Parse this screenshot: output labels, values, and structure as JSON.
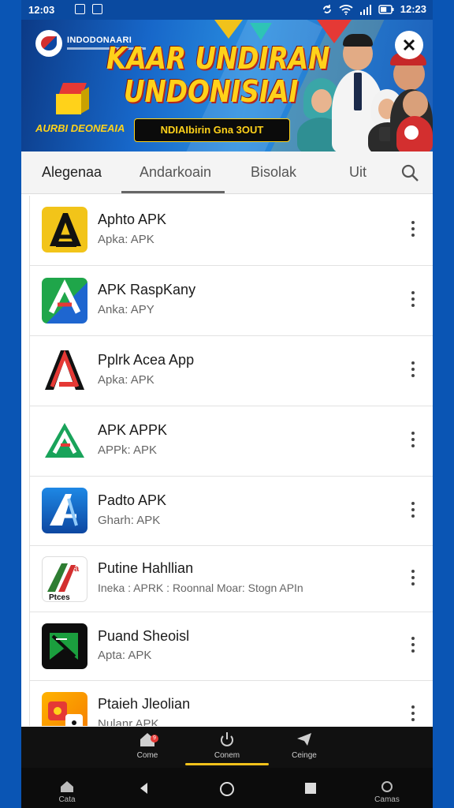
{
  "status_bar": {
    "time": "12:03",
    "clock_right": "12:23",
    "battery_percent": 60
  },
  "banner": {
    "brand": "INDODONAARI",
    "headline_line1": "KAAR UNDIRAN",
    "headline_line2": "UNDONISIAI",
    "tagline": "AURBI DEONEAIA",
    "pill_text": "NDIAIbirin  Gna 3OUT",
    "colors": {
      "accent_yellow": "#ffd21a",
      "accent_red": "#e53935",
      "banner_blue": "#1767c9"
    }
  },
  "tabs": {
    "items": [
      "Alegenaa",
      "Andarkoain",
      "Bisolak",
      "Uit"
    ],
    "active_index": 1
  },
  "apps": [
    {
      "title": "Aphto APK",
      "subtitle": "Apka: APK",
      "icon": "yellow-a-icon",
      "color": "#f2c419"
    },
    {
      "title": "APK RaspKany",
      "subtitle": "Anka: APY",
      "icon": "green-blue-a-icon",
      "color": "#1fa64a"
    },
    {
      "title": "Pplrk Acea App",
      "subtitle": "Apka: APK",
      "icon": "red-black-a-icon",
      "color": "#d32f2f"
    },
    {
      "title": "APK APPK",
      "subtitle": "APPk: APK",
      "icon": "green-triangle-a-icon",
      "color": "#19a35a"
    },
    {
      "title": "Padto APK",
      "subtitle": "Gharh: APK",
      "icon": "blue-a-icon",
      "color": "#1565c0"
    },
    {
      "title": "Putine Hahllian",
      "subtitle": "Ineka : APRK : Roonnal Moar: Stogn APIn",
      "icon": "flag-a-icon",
      "color": "#2e7d32"
    },
    {
      "title": "Puand Sheoisl",
      "subtitle": "Apta: APK",
      "icon": "green-flag-icon",
      "color": "#1b9e3e"
    },
    {
      "title": "Ptaieh Jleolian",
      "subtitle": "Nulanr APK",
      "icon": "orange-dice-icon",
      "color": "#f57c00"
    }
  ],
  "app_bar": {
    "items": [
      {
        "label": "Come",
        "icon": "home-icon",
        "badge": "9"
      },
      {
        "label": "Conem",
        "icon": "power-icon"
      },
      {
        "label": "Ceinge",
        "icon": "send-icon"
      }
    ],
    "active_index": 1
  },
  "system_nav": {
    "left_label": "Cata",
    "right_label": "Camas"
  }
}
